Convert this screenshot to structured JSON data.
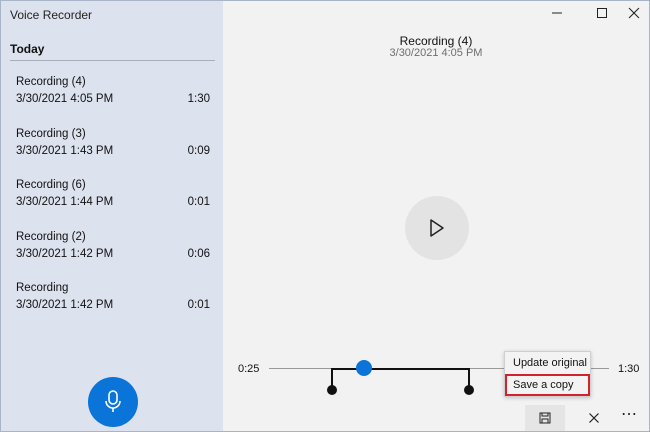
{
  "app": {
    "title": "Voice Recorder"
  },
  "sidebar": {
    "section_title": "Today",
    "recordings": [
      {
        "name": "Recording (4)",
        "date": "3/30/2021 4:05 PM",
        "duration": "1:30"
      },
      {
        "name": "Recording (3)",
        "date": "3/30/2021 1:43 PM",
        "duration": "0:09"
      },
      {
        "name": "Recording (6)",
        "date": "3/30/2021 1:44 PM",
        "duration": "0:01"
      },
      {
        "name": "Recording (2)",
        "date": "3/30/2021 1:42 PM",
        "duration": "0:06"
      },
      {
        "name": "Recording",
        "date": "3/30/2021 1:42 PM",
        "duration": "0:01"
      }
    ]
  },
  "main": {
    "title": "Recording (4)",
    "date": "3/30/2021 4:05 PM"
  },
  "timeline": {
    "current": "0:25",
    "total": "1:30"
  },
  "menu": {
    "items": [
      "Update original",
      "Save a copy"
    ]
  },
  "toolbar": {
    "more": "⋯"
  },
  "colors": {
    "accent": "#0a74d8",
    "highlight": "#d3222a",
    "sidebar": "#dde2ef"
  },
  "icons": [
    "microphone-icon",
    "play-icon",
    "save-icon",
    "close-icon",
    "more-icon",
    "minimize-icon",
    "maximize-icon"
  ]
}
